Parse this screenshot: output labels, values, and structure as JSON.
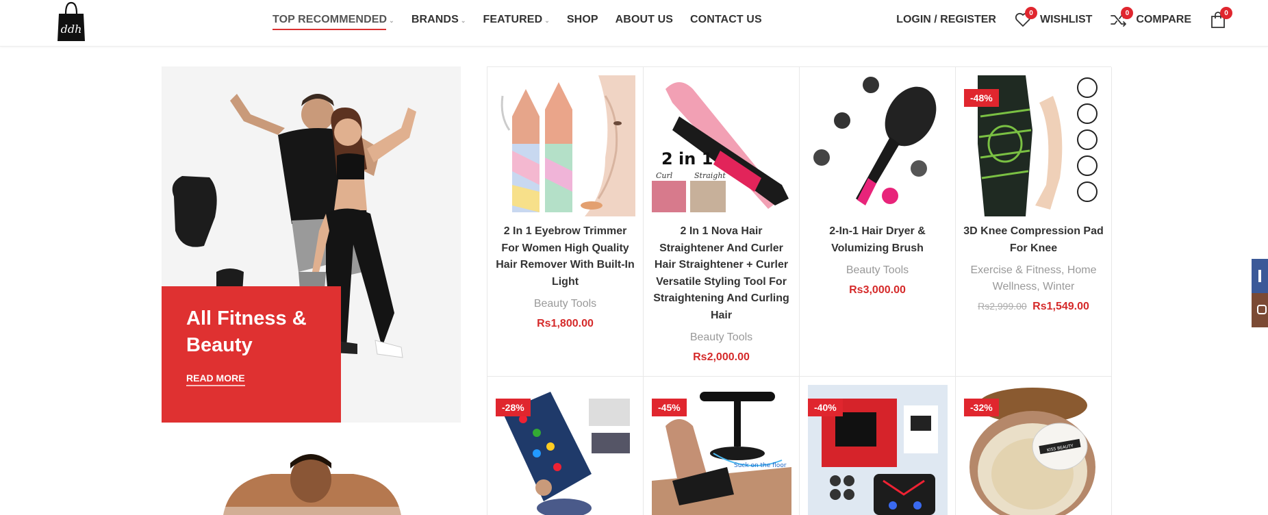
{
  "header": {
    "nav": [
      {
        "label": "TOP RECOMMENDED",
        "dropdown": true,
        "active": true
      },
      {
        "label": "BRANDS",
        "dropdown": true
      },
      {
        "label": "FEATURED",
        "dropdown": true
      },
      {
        "label": "SHOP",
        "dropdown": false
      },
      {
        "label": "ABOUT US",
        "dropdown": false
      },
      {
        "label": "CONTACT US",
        "dropdown": false
      }
    ],
    "login_label": "LOGIN / REGISTER",
    "wishlist_label": "WISHLIST",
    "wishlist_count": "0",
    "compare_label": "COMPARE",
    "compare_count": "0",
    "cart_count": "0"
  },
  "banner": {
    "title": "All Fitness & Beauty",
    "link": "READ MORE"
  },
  "products": [
    {
      "name": "2 In 1 Eyebrow Trimmer For Women High Quality Hair Remover With Built-In Light",
      "category": "Beauty Tools",
      "price": "Rs1,800.00",
      "old_price": "",
      "sale": ""
    },
    {
      "name": "2 In 1 Nova Hair Straightener And Curler Hair Straightener + Curler Versatile Styling Tool For Straightening And Curling Hair",
      "category": "Beauty Tools",
      "price": "Rs2,000.00",
      "old_price": "",
      "sale": ""
    },
    {
      "name": "2-In-1 Hair Dryer & Volumizing Brush",
      "category": "Beauty Tools",
      "price": "Rs3,000.00",
      "old_price": "",
      "sale": ""
    },
    {
      "name": "3D Knee Compression Pad For Knee",
      "category": "Exercise & Fitness, Home Wellness, Winter",
      "price": "Rs1,549.00",
      "old_price": "Rs2,999.00",
      "sale": "-48%"
    },
    {
      "name": "",
      "category": "",
      "price": "",
      "old_price": "",
      "sale": "-28%"
    },
    {
      "name": "",
      "category": "",
      "price": "",
      "old_price": "",
      "sale": "-45%"
    },
    {
      "name": "",
      "category": "",
      "price": "",
      "old_price": "",
      "sale": "-40%"
    },
    {
      "name": "",
      "category": "",
      "price": "",
      "old_price": "",
      "sale": "-32%"
    }
  ],
  "product_images": {
    "p2_text": "2 in 1",
    "p2_curl": "Curl",
    "p2_straight": "Straight",
    "p8_brand": "KISS BEAUTY",
    "p6_caption": "Suck on the floor"
  },
  "colors": {
    "accent": "#df3131",
    "sale_badge": "#e0262e",
    "price": "#d52a2a",
    "facebook": "#3b5998",
    "instagram": "#7b4a34"
  },
  "icons": {
    "wishlist": "heart-icon",
    "compare": "shuffle-icon",
    "cart": "shopping-bag-icon"
  }
}
